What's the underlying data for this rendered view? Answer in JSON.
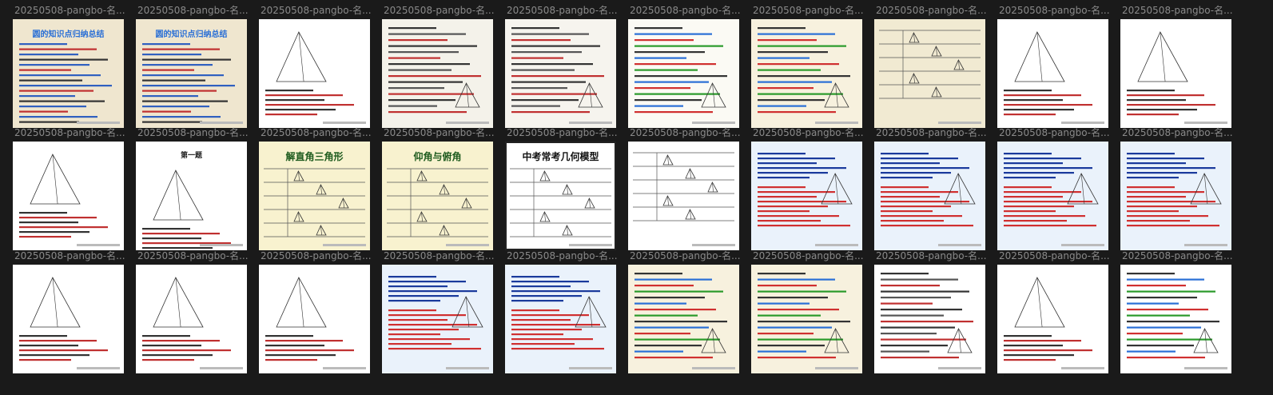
{
  "thumbnails": [
    {
      "caption": "20250508-pangbo-名...",
      "bg": "#efe6cf",
      "kind": "text-blue",
      "title": "圆的知识点归纳总结"
    },
    {
      "caption": "20250508-pangbo-名...",
      "bg": "#efe6cf",
      "kind": "text-blue",
      "title": "圆的知识点归纳总结"
    },
    {
      "caption": "20250508-pangbo-名...",
      "bg": "#ffffff",
      "kind": "geometry"
    },
    {
      "caption": "20250508-pangbo-名...",
      "bg": "#f4f2ea",
      "kind": "notes"
    },
    {
      "caption": "20250508-pangbo-名...",
      "bg": "#f6f4ee",
      "kind": "notes"
    },
    {
      "caption": "20250508-pangbo-名...",
      "bg": "#fbfaf4",
      "kind": "notes-color"
    },
    {
      "caption": "20250508-pangbo-名...",
      "bg": "#f7f1de",
      "kind": "notes-color"
    },
    {
      "caption": "20250508-pangbo-名...",
      "bg": "#f1ead2",
      "kind": "table"
    },
    {
      "caption": "20250508-pangbo-名...",
      "bg": "#ffffff",
      "kind": "geometry"
    },
    {
      "caption": "20250508-pangbo-名...",
      "bg": "#ffffff",
      "kind": "geometry"
    },
    {
      "caption": "20250508-pangbo-名...",
      "bg": "#ffffff",
      "kind": "geometry"
    },
    {
      "caption": "20250508-pangbo-名...",
      "bg": "#ffffff",
      "kind": "geometry",
      "title": "第一题"
    },
    {
      "caption": "20250508-pangbo-名...",
      "bg": "#f8f2cf",
      "kind": "table",
      "title": "解直角三角形"
    },
    {
      "caption": "20250508-pangbo-名...",
      "bg": "#f8f2cf",
      "kind": "table",
      "title": "仰角与俯角"
    },
    {
      "caption": "20250508-pangbo-名...",
      "bg": "#ffffff",
      "kind": "table-dark",
      "title": "中考常考几何模型"
    },
    {
      "caption": "20250508-pangbo-名...",
      "bg": "#ffffff",
      "kind": "table"
    },
    {
      "caption": "20250508-pangbo-名...",
      "bg": "#eaf2fb",
      "kind": "text-red"
    },
    {
      "caption": "20250508-pangbo-名...",
      "bg": "#eaf2fb",
      "kind": "text-red"
    },
    {
      "caption": "20250508-pangbo-名...",
      "bg": "#eaf2fb",
      "kind": "text-red"
    },
    {
      "caption": "20250508-pangbo-名...",
      "bg": "#eaf2fb",
      "kind": "text-red"
    },
    {
      "caption": "20250508-pangbo-名...",
      "bg": "#ffffff",
      "kind": "geometry"
    },
    {
      "caption": "20250508-pangbo-名...",
      "bg": "#ffffff",
      "kind": "geometry"
    },
    {
      "caption": "20250508-pangbo-名...",
      "bg": "#ffffff",
      "kind": "geometry"
    },
    {
      "caption": "20250508-pangbo-名...",
      "bg": "#eaf2fb",
      "kind": "text-red"
    },
    {
      "caption": "20250508-pangbo-名...",
      "bg": "#eaf2fb",
      "kind": "text-red"
    },
    {
      "caption": "20250508-pangbo-名...",
      "bg": "#f7f1de",
      "kind": "notes-color"
    },
    {
      "caption": "20250508-pangbo-名...",
      "bg": "#f7f1de",
      "kind": "notes-color"
    },
    {
      "caption": "20250508-pangbo-名...",
      "bg": "#ffffff",
      "kind": "notes"
    },
    {
      "caption": "20250508-pangbo-名...",
      "bg": "#ffffff",
      "kind": "geometry"
    },
    {
      "caption": "20250508-pangbo-名...",
      "bg": "#ffffff",
      "kind": "notes-color"
    }
  ]
}
